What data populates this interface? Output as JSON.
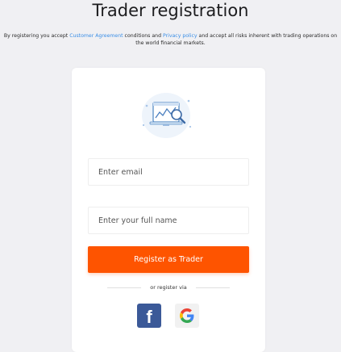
{
  "header": {
    "title": "Trader registration"
  },
  "terms": {
    "prefix": "By registering you accept ",
    "customer_agreement": "Customer Agreement",
    "middle": " conditions and ",
    "privacy_policy": "Privacy policy",
    "suffix": " and accept all risks inherent with trading operations on the world financial markets."
  },
  "form": {
    "email_placeholder": "Enter email",
    "name_placeholder": "Enter your full name",
    "register_button": "Register as Trader",
    "divider_text": "or register via"
  },
  "social": {
    "facebook_letter": "f",
    "google_icon": "google-icon"
  },
  "colors": {
    "accent": "#fe5400",
    "link": "#3a8ee6",
    "facebook": "#3b5998",
    "background": "#f0f0f3"
  }
}
